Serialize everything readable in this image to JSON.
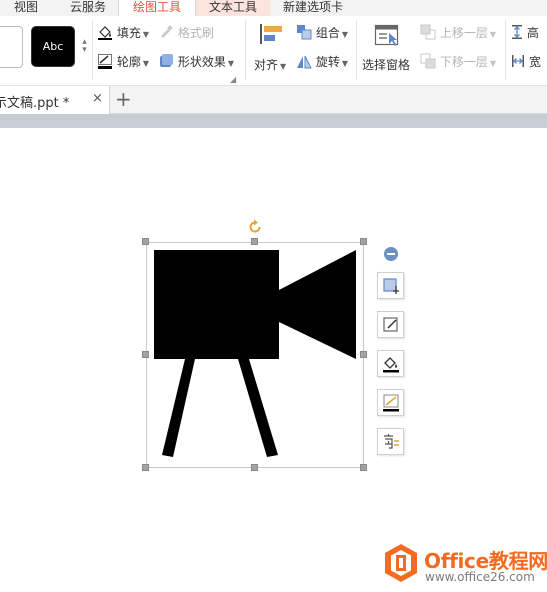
{
  "menu": {
    "tabs": [
      {
        "label": "视图"
      },
      {
        "label": "云服务"
      },
      {
        "label": "绘图工具"
      },
      {
        "label": "文本工具"
      },
      {
        "label": "新建选项卡"
      }
    ],
    "active_tab": "绘图工具"
  },
  "ribbon": {
    "style_swatch_label": "Abc",
    "fill_label": "填充",
    "format_painter_label": "格式刷",
    "outline_label": "轮廓",
    "shape_effects_label": "形状效果",
    "align_label": "对齐",
    "group_label": "组合",
    "rotate_label": "旋转",
    "selection_pane_label": "选择窗格",
    "bring_forward_label": "上移一层",
    "send_backward_label": "下移一层",
    "height_label": "高",
    "width_label": "宽"
  },
  "document": {
    "tab_label": "示文稿.ppt *",
    "close_symbol": "×",
    "new_tab_symbol": "+"
  },
  "float_toolbar": {
    "icons": [
      "crop-shape-icon",
      "shape-style-icon",
      "fill-bucket-icon",
      "outline-pen-icon",
      "text-wrap-icon"
    ]
  },
  "watermark": {
    "title": "Office教程网",
    "url": "www.office26.com"
  },
  "colors": {
    "accent_tab": "#e4543a",
    "shape_fill": "#000000",
    "watermark_orange": "#f26b22",
    "rotate_handle": "#e8a33a"
  }
}
